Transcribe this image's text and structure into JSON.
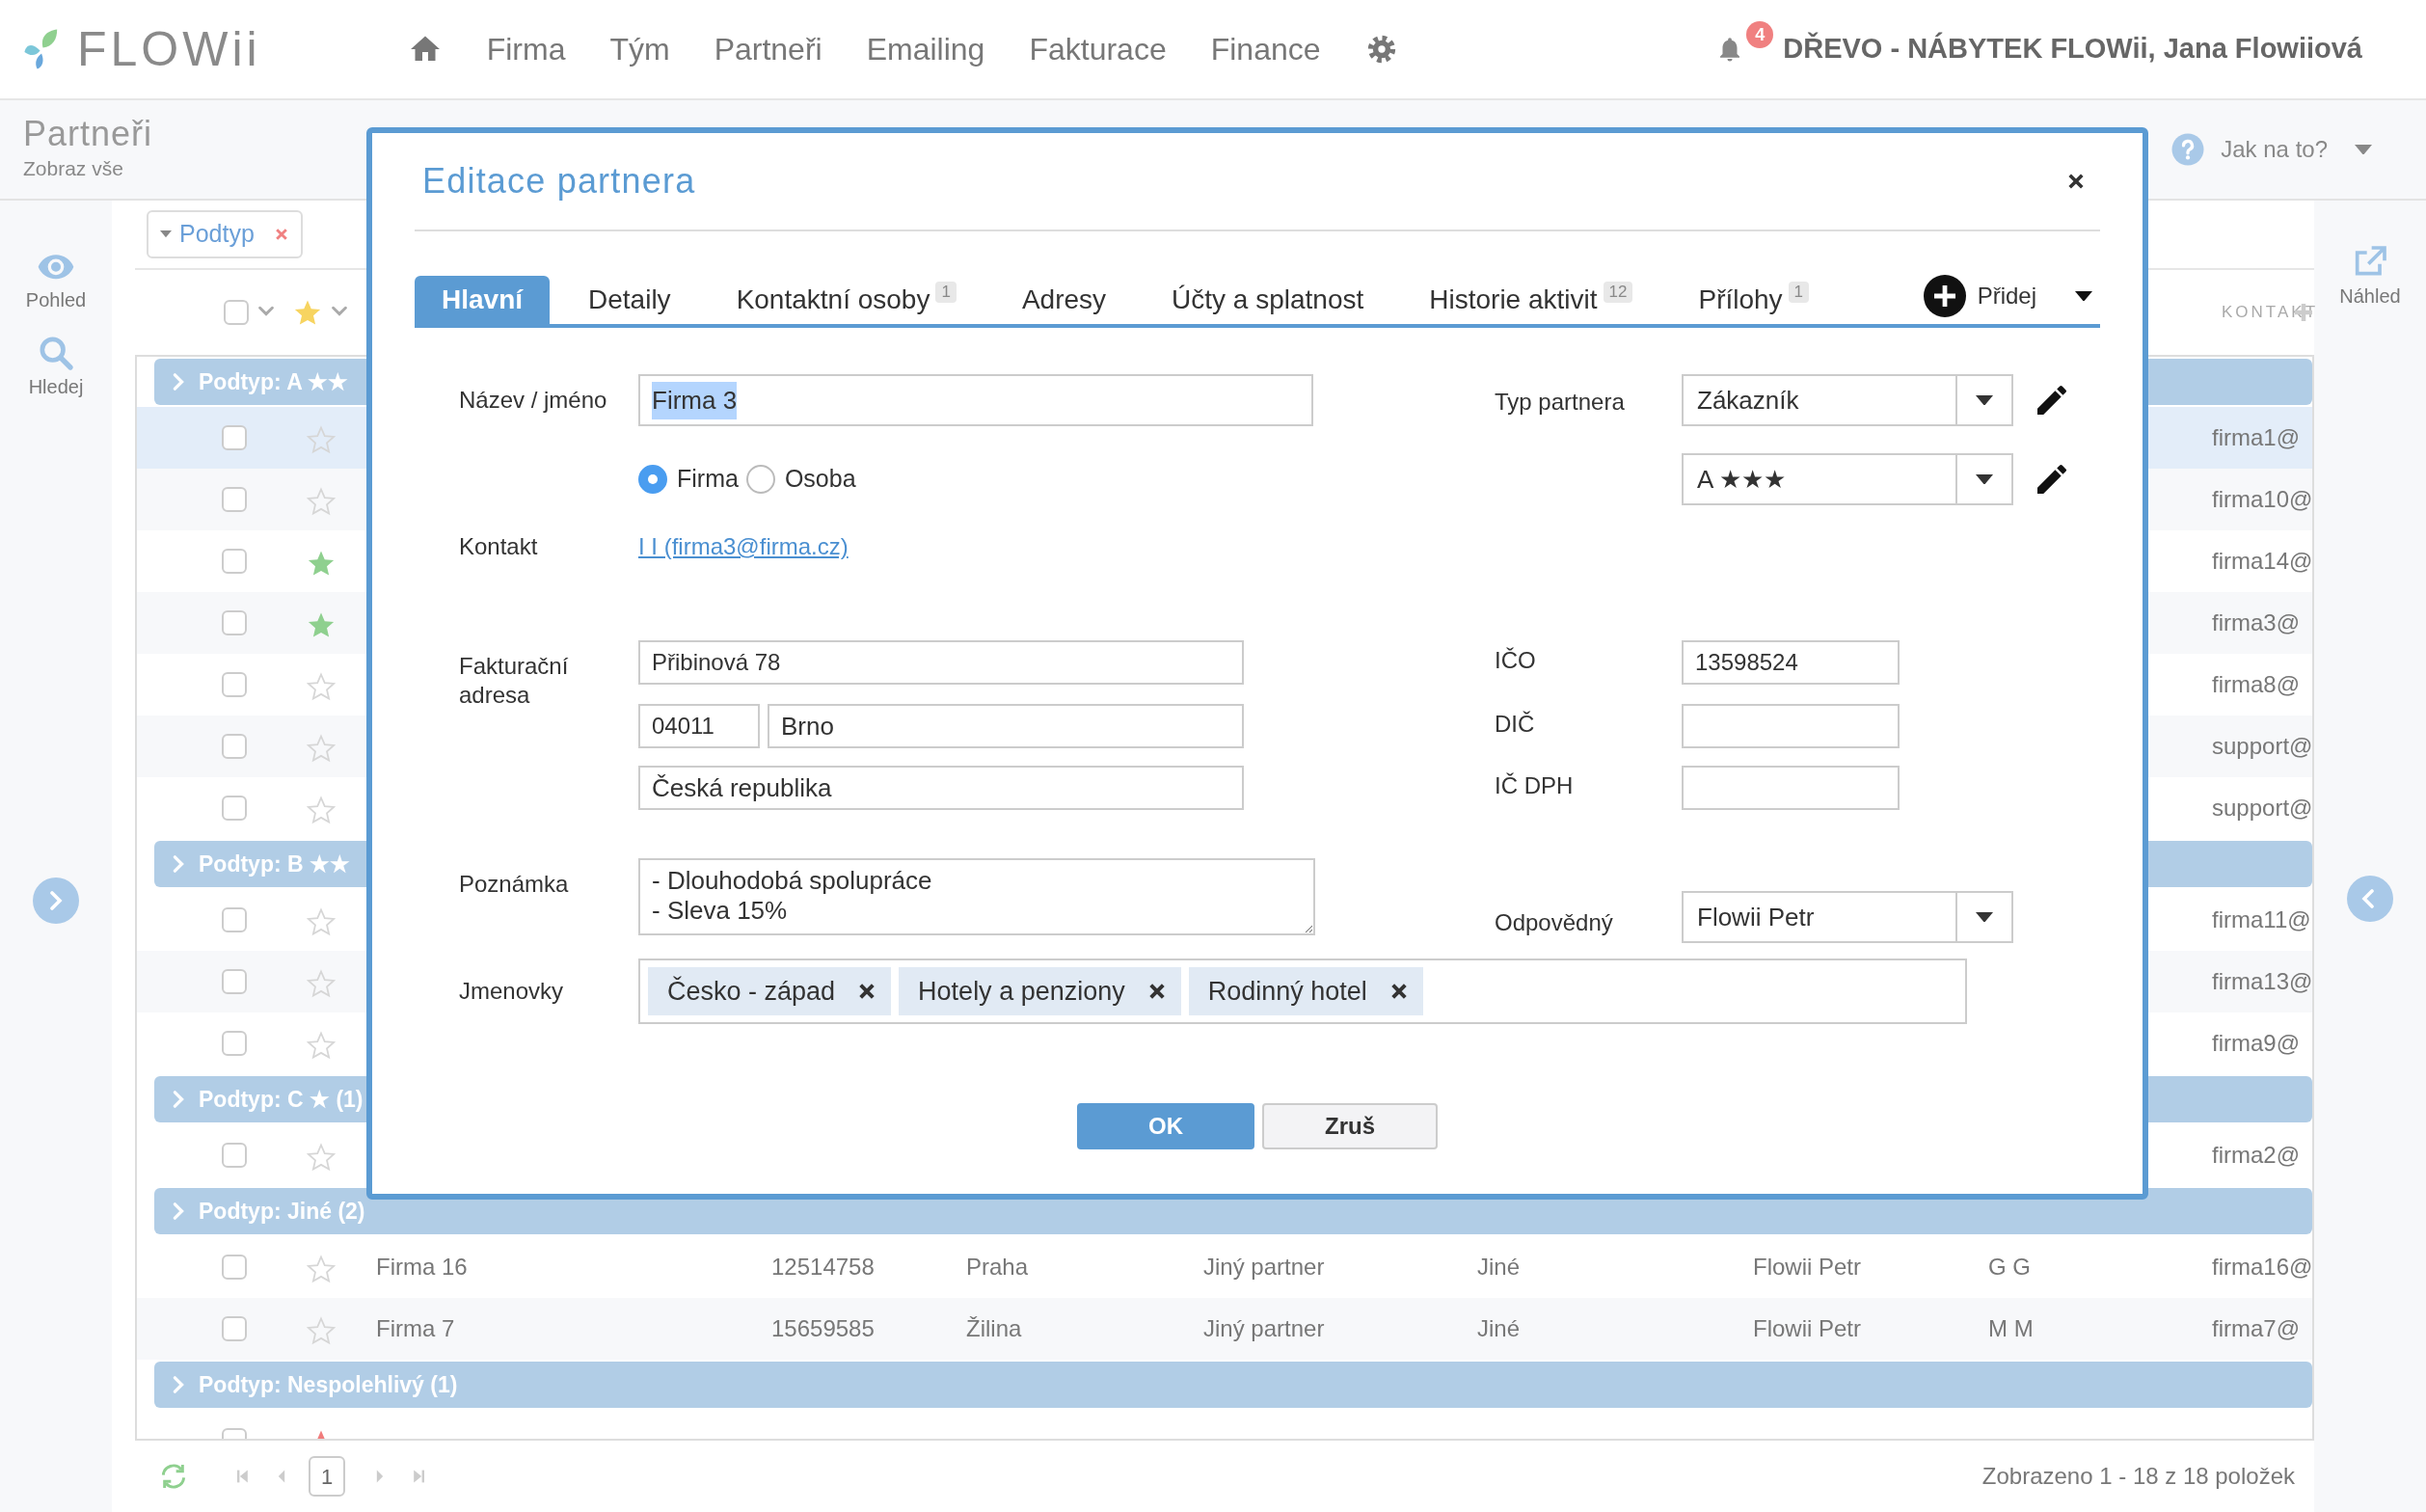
{
  "app": {
    "logo": "FLOWii",
    "nav": [
      "Firma",
      "Tým",
      "Partneři",
      "Emailing",
      "Fakturace",
      "Finance"
    ],
    "notifications": "4",
    "account": "DŘEVO - NÁBYTEK FLOWii, Jana Flowiiová"
  },
  "page": {
    "title": "Partneři",
    "subtitle": "Zobraz vše",
    "help": "Jak na to?"
  },
  "left_sidebar": [
    {
      "label": "Pohled",
      "kind": "eye"
    },
    {
      "label": "Hledej",
      "kind": "search"
    }
  ],
  "right_sidebar": [
    {
      "label": "Náhled",
      "kind": "preview"
    }
  ],
  "grid": {
    "group_chip": "Podtyp",
    "header": {
      "all_checked": false,
      "column_label": "KONTAKT"
    },
    "groups": [
      {
        "label": "Podtyp: A ★★",
        "rows": [
          {
            "checked": false,
            "starred": false,
            "selected": true,
            "email": "firma1@"
          },
          {
            "checked": false,
            "starred": false,
            "selected": false,
            "email": "firma10@"
          },
          {
            "checked": false,
            "starred": true,
            "color": "#8fd08f",
            "selected": false,
            "email": "firma14@"
          },
          {
            "checked": false,
            "starred": true,
            "color": "#8fd08f",
            "selected": false,
            "email": "firma3@"
          },
          {
            "checked": false,
            "starred": false,
            "selected": false,
            "email": "firma8@"
          },
          {
            "checked": false,
            "starred": false,
            "selected": false,
            "email": "support@"
          },
          {
            "checked": false,
            "starred": false,
            "selected": false,
            "email": "support@"
          }
        ]
      },
      {
        "label": "Podtyp: B ★★",
        "rows": [
          {
            "checked": false,
            "starred": false,
            "selected": false,
            "email": "firma11@"
          },
          {
            "checked": false,
            "starred": false,
            "selected": false,
            "email": "firma13@"
          },
          {
            "checked": false,
            "starred": false,
            "selected": false,
            "email": "firma9@"
          }
        ]
      },
      {
        "label": "Podtyp: C ★ (1)",
        "rows": [
          {
            "checked": false,
            "starred": false,
            "selected": false,
            "email": "firma2@"
          }
        ]
      },
      {
        "label": "Podtyp: Jiné (2)",
        "rows": [
          {
            "checked": false,
            "starred": false,
            "selected": false,
            "name": "Firma 16",
            "ico": "12514758",
            "city": "Praha",
            "type": "Jiný partner",
            "subtype": "Jiné",
            "owner": "Flowii Petr",
            "contact": "G G",
            "email": "firma16@"
          },
          {
            "checked": false,
            "starred": false,
            "selected": false,
            "name": "Firma 7",
            "ico": "15659585",
            "city": "Žilina",
            "type": "Jiný partner",
            "subtype": "Jiné",
            "owner": "Flowii Petr",
            "contact": "M M",
            "email": "firma7@"
          }
        ]
      },
      {
        "label": "Podtyp: Nespolehlivý (1)",
        "rows": [
          {
            "checked": false,
            "starred": true,
            "color": "#f07c7c",
            "selected": false
          }
        ]
      }
    ],
    "footer": {
      "page": "1",
      "summary": "Zobrazeno 1 - 18 z 18 položek"
    }
  },
  "modal": {
    "title": "Editace partnera",
    "tabs": [
      {
        "label": "Hlavní",
        "selected": true
      },
      {
        "label": "Detaily",
        "selected": false
      },
      {
        "label": "Kontaktní osoby",
        "count": "1",
        "selected": false
      },
      {
        "label": "Adresy",
        "selected": false
      },
      {
        "label": "Účty a splatnost",
        "selected": false
      },
      {
        "label": "Historie aktivit",
        "count": "12",
        "selected": false
      },
      {
        "label": "Přílohy",
        "count": "1",
        "selected": false
      }
    ],
    "add_button": "Přidej",
    "form": {
      "name": {
        "label": "Název / jméno",
        "value": "Firma 3",
        "highlighted": true
      },
      "entity_type": [
        {
          "label": "Firma",
          "selected": true
        },
        {
          "label": "Osoba",
          "selected": false
        }
      ],
      "contact": {
        "label": "Kontakt",
        "link": "I I (firma3@firma.cz)"
      },
      "billing_address": {
        "label": "Fakturační adresa",
        "street": "Přibinová 78",
        "zip": "04011",
        "city": "Brno",
        "country": "Česká republika"
      },
      "note": {
        "label": "Poznámka",
        "value": "- Dlouhodobá spolupráce\n- Sleva 15%"
      },
      "tags": {
        "label": "Jmenovky",
        "items": [
          "Česko - západ",
          "Hotely a penziony",
          "Rodinný hotel"
        ]
      },
      "partner_type": {
        "label": "Typ partnera",
        "value": "Zákazník"
      },
      "rating": {
        "value": "A ★★★"
      },
      "ico": {
        "label": "IČO",
        "value": "13598524"
      },
      "dic": {
        "label": "DIČ"
      },
      "ic_dph": {
        "label": "IČ DPH"
      },
      "owner": {
        "label": "Odpovědný",
        "value": "Flowii Petr"
      }
    },
    "buttons": [
      {
        "label": "OK",
        "kind": "primary"
      },
      {
        "label": "Zruš",
        "kind": "secondary"
      }
    ]
  }
}
